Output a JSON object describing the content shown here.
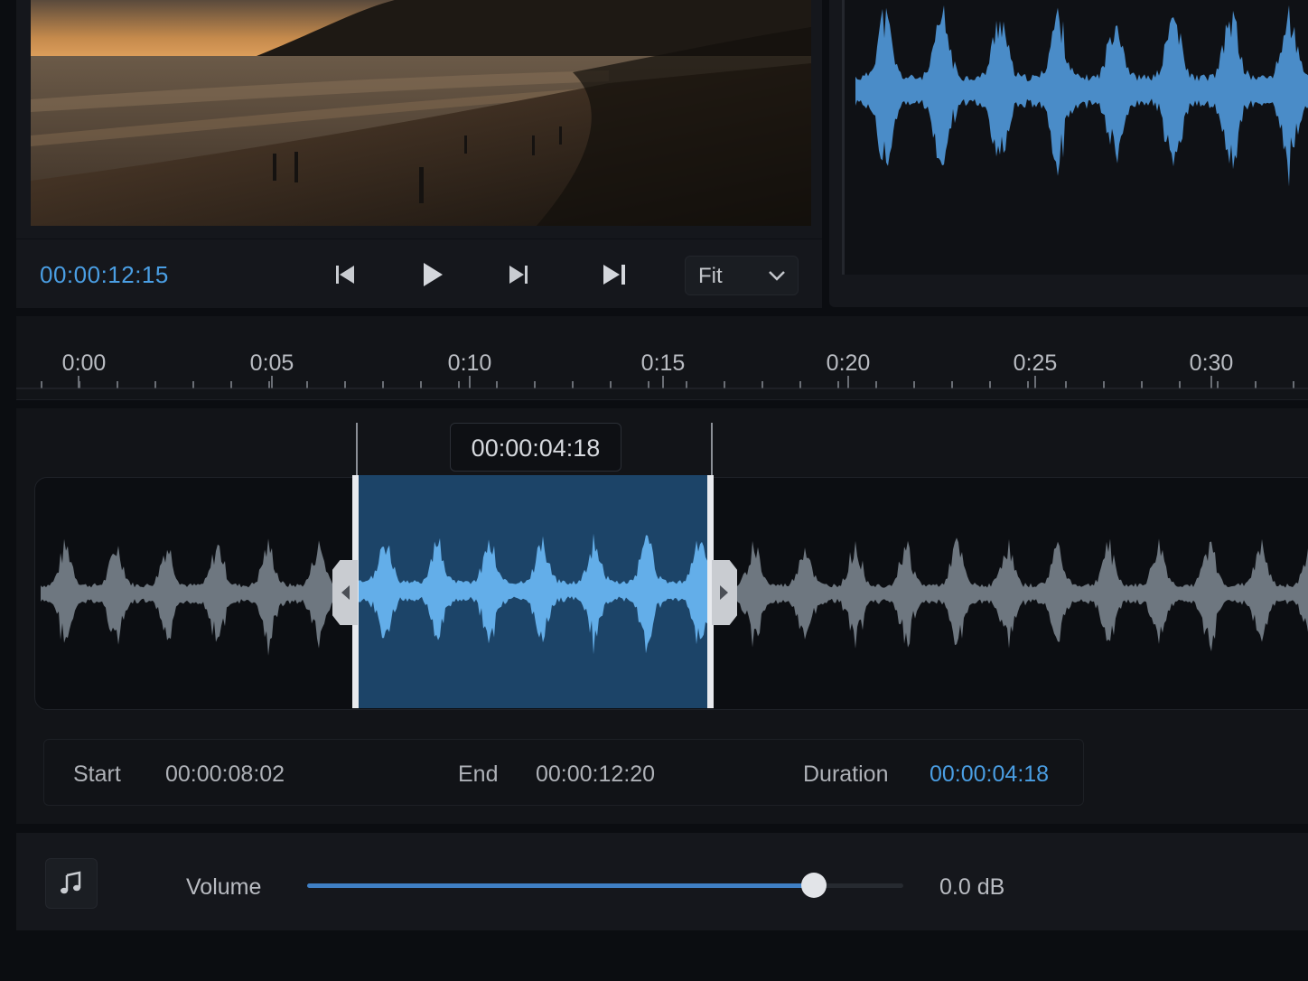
{
  "preview": {
    "timecode": "00:00:12:15",
    "zoom_select": "Fit"
  },
  "transport": {
    "buttons": [
      "skip-to-start",
      "play",
      "step-forward",
      "skip-to-end"
    ]
  },
  "ruler": {
    "labels": [
      "0:00",
      "0:05",
      "0:10",
      "0:15",
      "0:20",
      "0:25",
      "0:30"
    ]
  },
  "selection": {
    "duration_tag": "00:00:04:18"
  },
  "info": {
    "start_label": "Start",
    "start_value": "00:00:08:02",
    "end_label": "End",
    "end_value": "00:00:12:20",
    "duration_label": "Duration",
    "duration_value": "00:00:04:18"
  },
  "volume": {
    "label": "Volume",
    "value_text": "0.0 dB",
    "level": 0.85
  },
  "colors": {
    "accent": "#4a9ee3",
    "selection": "#1c4468",
    "waveform_active": "#63aee9",
    "waveform_inactive": "#6e7780"
  }
}
